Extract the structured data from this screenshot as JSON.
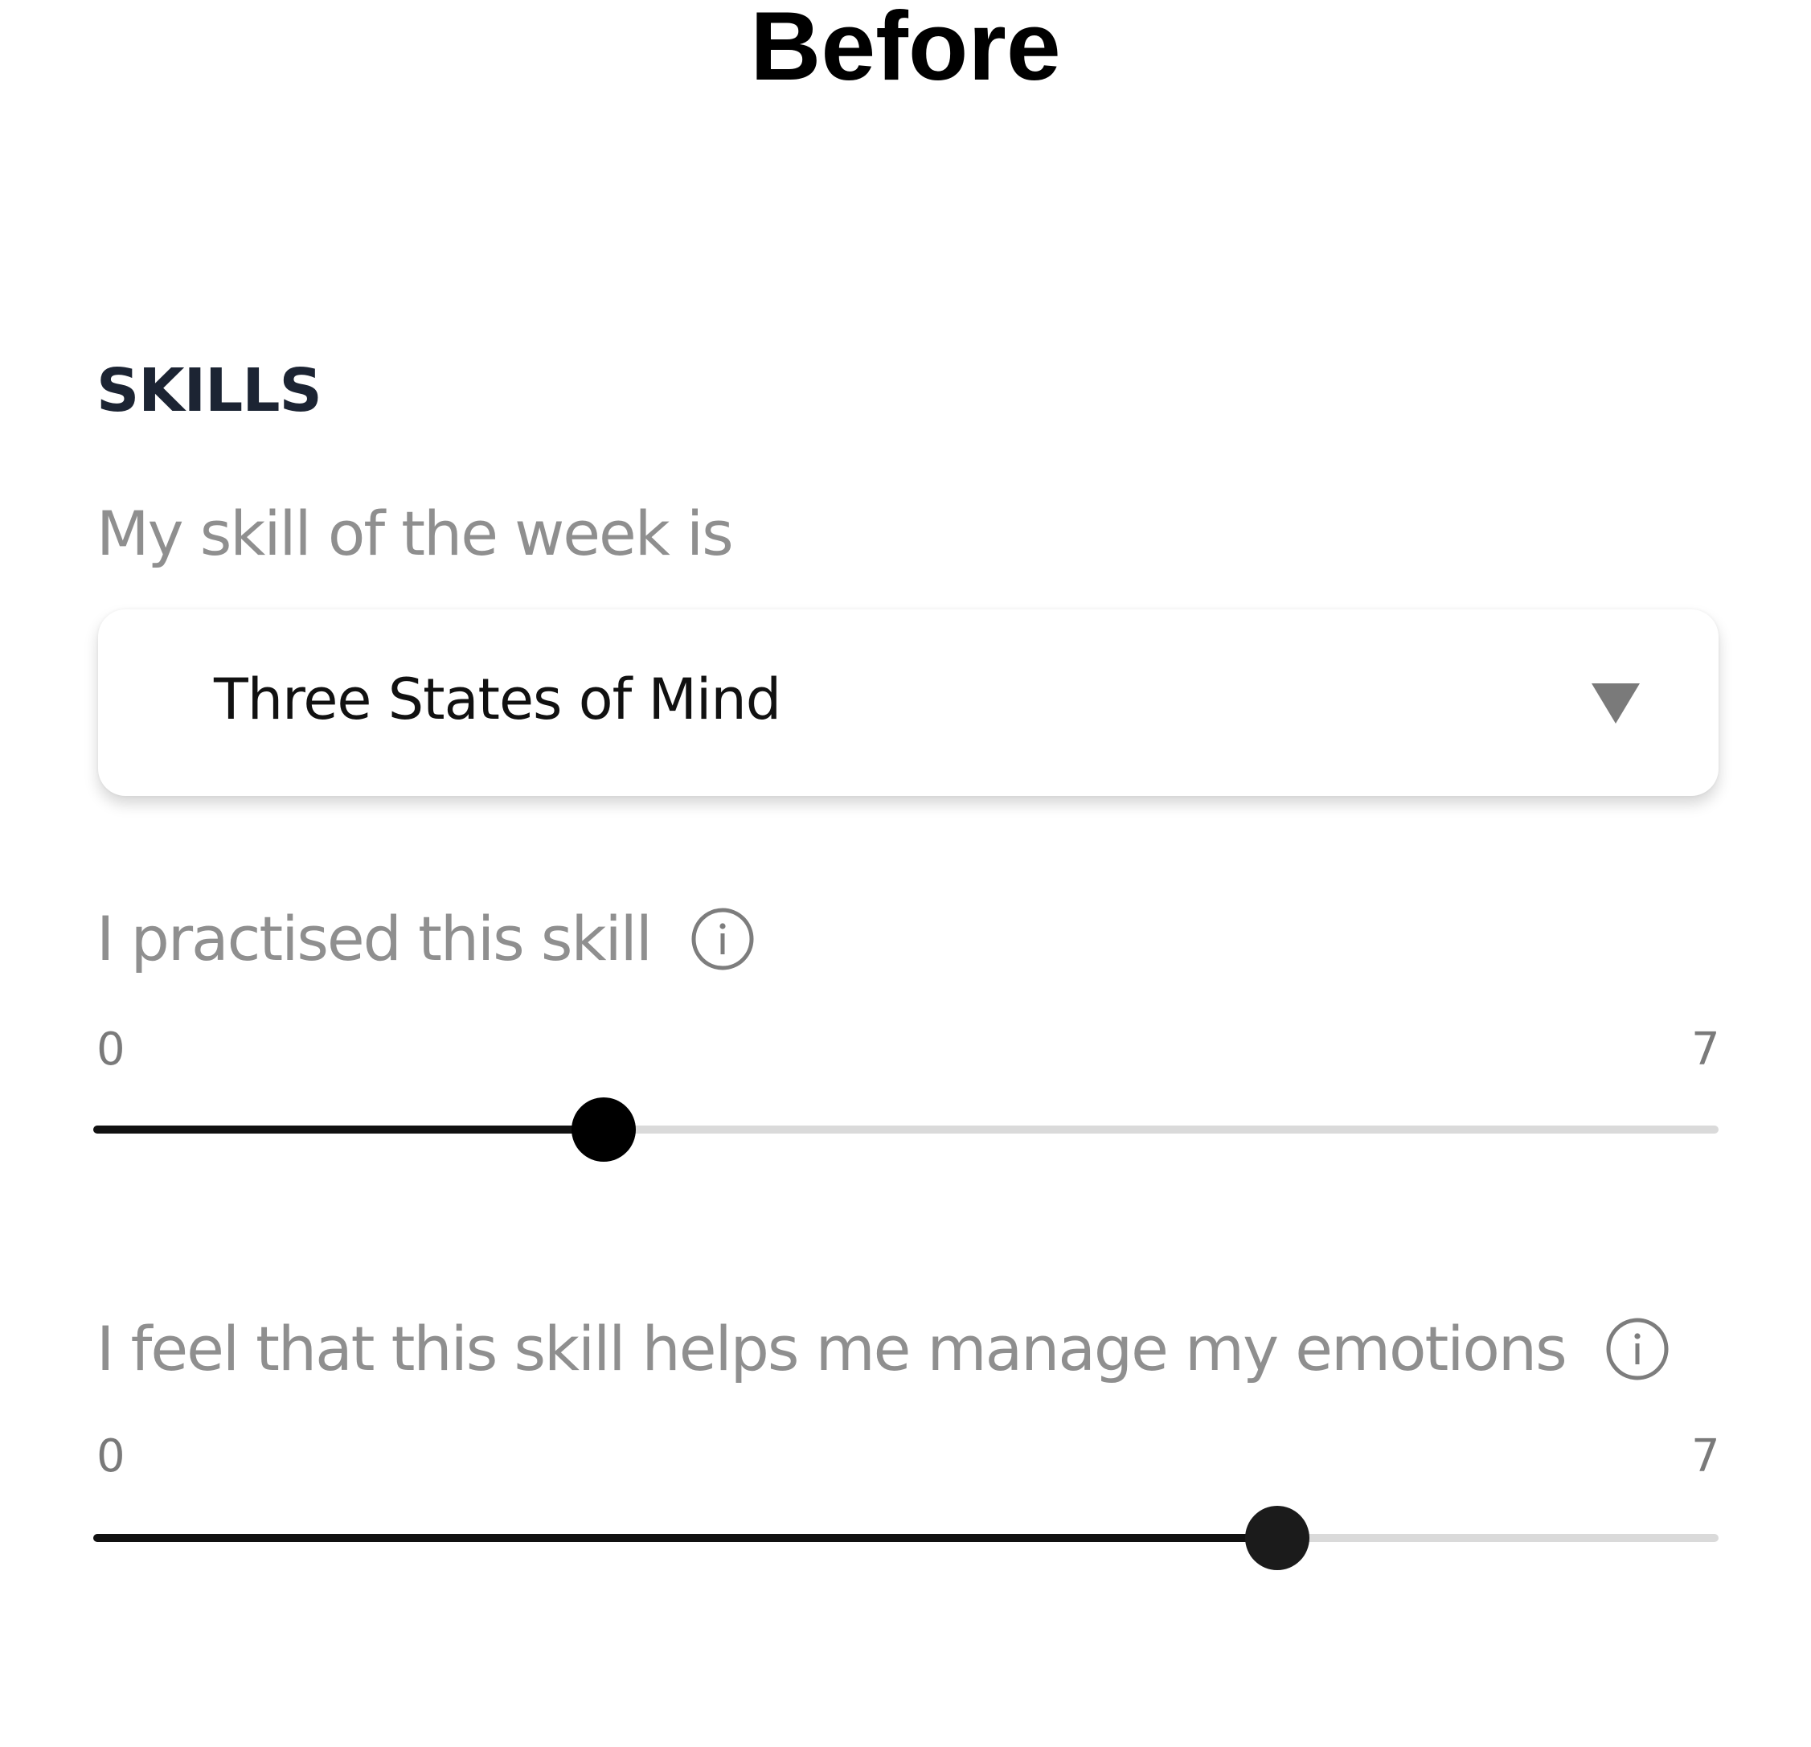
{
  "banner": {
    "title": "Before"
  },
  "skills": {
    "section_title": "SKILLS",
    "skill_of_week": {
      "label": "My skill of the week is",
      "selected": "Three States of Mind",
      "arrow_icon": "triangle-down-icon"
    },
    "practised": {
      "label": "I practised this skill",
      "info_icon": "info-icon",
      "min_label": "0",
      "max_label": "7",
      "min": 0,
      "max": 7,
      "value": 2.2
    },
    "helps_emotions": {
      "label": "I feel that this skill helps me manage my emotions",
      "info_icon": "info-icon",
      "min_label": "0",
      "max_label": "7",
      "min": 0,
      "max": 7,
      "value": 5.1
    }
  },
  "colors": {
    "title": "#1c2433",
    "label_gray": "#8f8f8f",
    "slider_active": "#111111",
    "slider_inactive": "#dadada"
  }
}
